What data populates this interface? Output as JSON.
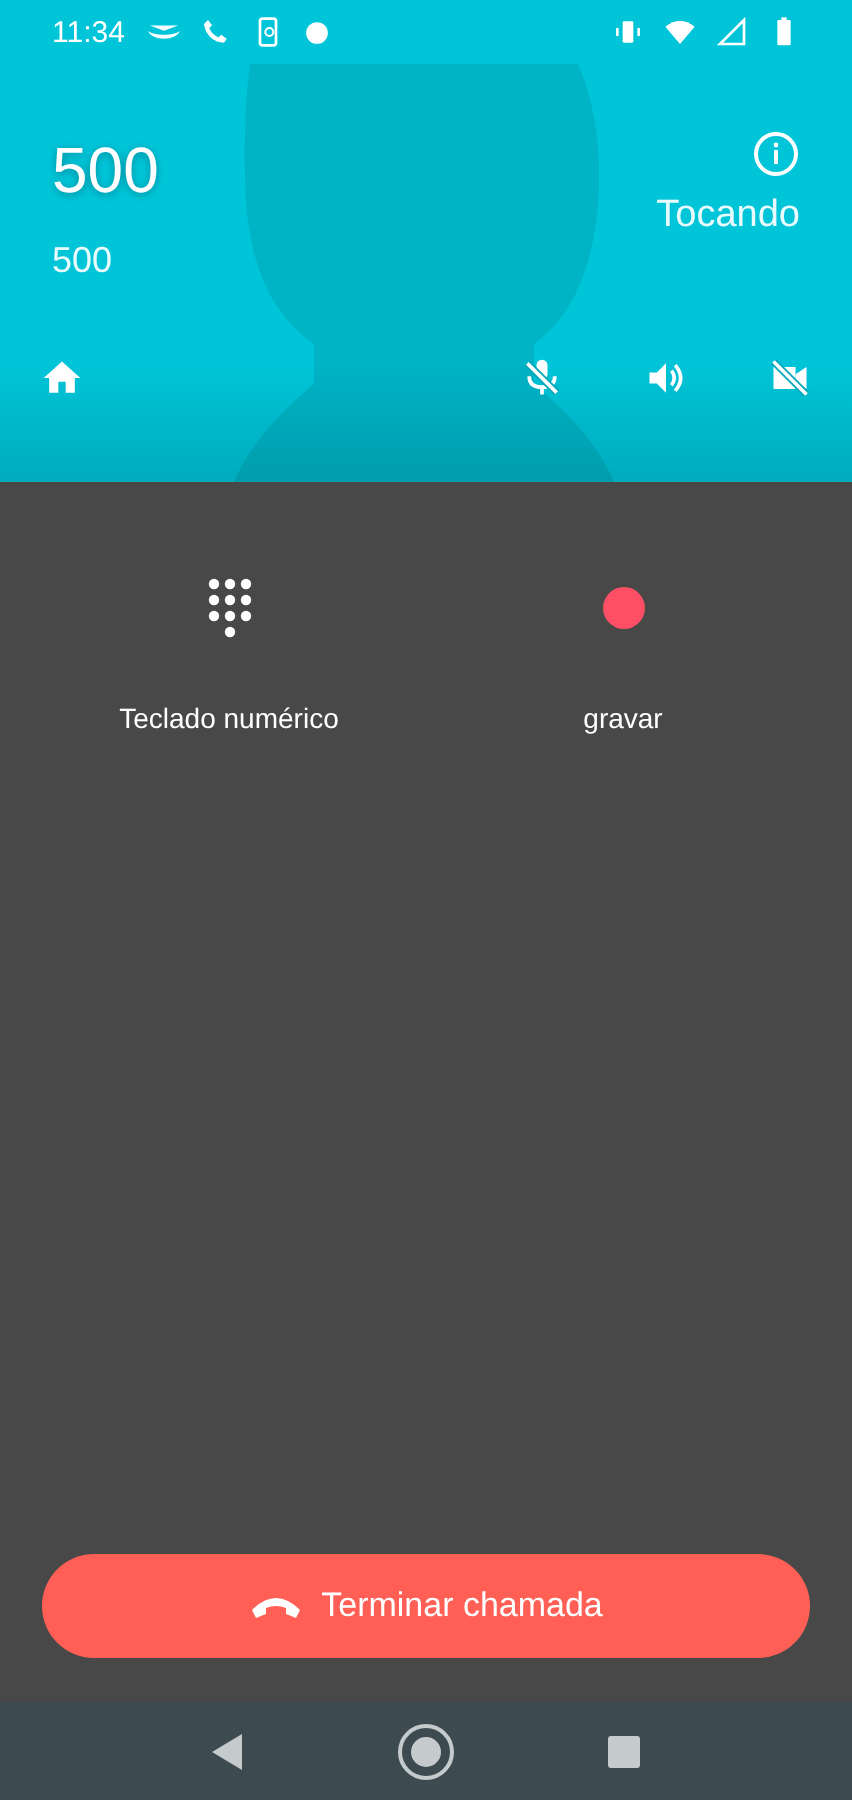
{
  "status_bar": {
    "time": "11:34"
  },
  "call": {
    "name": "500",
    "number": "500",
    "status": "Tocando"
  },
  "actions": [
    {
      "kind": "keypad",
      "label": "Teclado numérico"
    },
    {
      "kind": "record",
      "label": "gravar"
    }
  ],
  "end_call": {
    "label": "Terminar chamada"
  }
}
